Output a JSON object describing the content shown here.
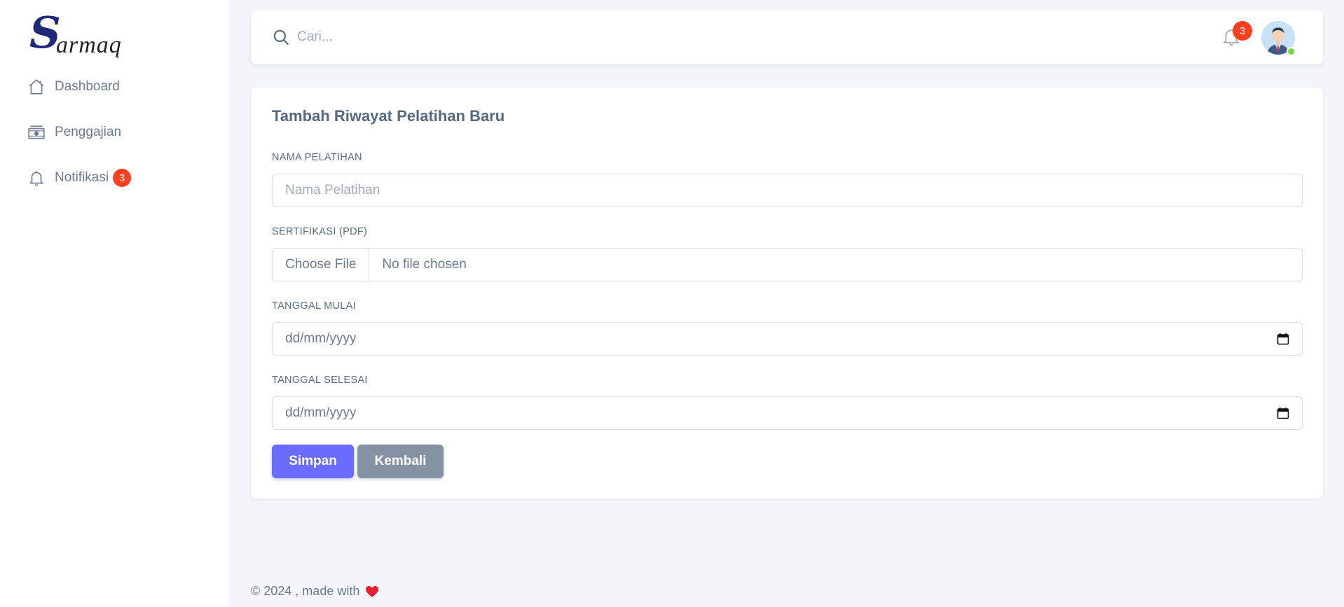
{
  "app": {
    "logo_text": "armaq",
    "logo_letter": "S"
  },
  "sidebar": {
    "items": [
      {
        "label": "Dashboard",
        "icon": "home-icon"
      },
      {
        "label": "Penggajian",
        "icon": "money-icon"
      },
      {
        "label": "Notifikasi",
        "icon": "bell-icon",
        "badge": "3"
      }
    ]
  },
  "topbar": {
    "search_placeholder": "Cari...",
    "notification_count": "3",
    "avatar": "user-avatar",
    "online_status_color": "#71dd37"
  },
  "form": {
    "title": "Tambah Riwayat Pelatihan Baru",
    "fields": {
      "nama_label": "NAMA PELATIHAN",
      "nama_placeholder": "Nama Pelatihan",
      "sertifikasi_label": "SERTIFIKASI (PDF)",
      "file_button": "Choose File",
      "file_status": "No file chosen",
      "tanggal_mulai_label": "TANGGAL MULAI",
      "tanggal_mulai_value": "dd/mm/yyyy",
      "tanggal_selesai_label": "TANGGAL SELESAI",
      "tanggal_selesai_value": "dd/mm/yyyy"
    },
    "buttons": {
      "save": "Simpan",
      "back": "Kembali"
    }
  },
  "footer": {
    "text": "© 2024 , made with"
  },
  "colors": {
    "primary": "#696cff",
    "secondary": "#8592a3",
    "badge": "#ff3e1d",
    "logo": "#1e2a78"
  }
}
